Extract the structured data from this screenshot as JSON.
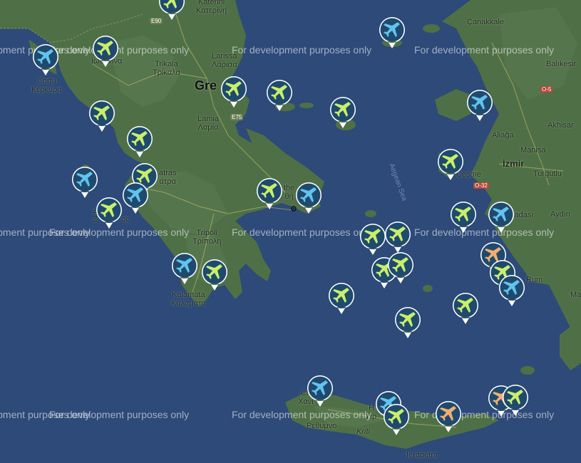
{
  "map": {
    "watermark_text": "For development purposes only",
    "sea_label": "Aegean Sea",
    "labels": [
      {
        "text": "Katerini\nΚατερίνη",
        "cls": ""
      },
      {
        "text": "Larissa\nΛάρισα",
        "cls": ""
      },
      {
        "text": "Trikala\nΤρίκαλα",
        "cls": ""
      },
      {
        "text": "Gre",
        "cls": "big"
      },
      {
        "text": "Lamia\nΛαμία",
        "cls": ""
      },
      {
        "text": "Corfu\nΚέρκυρα",
        "cls": ""
      },
      {
        "text": "atras\nάτρα",
        "cls": ""
      },
      {
        "text": "Tripoli\nΤρίπολη",
        "cls": ""
      },
      {
        "text": "Kalamata\nΚαλαμάτα",
        "cls": ""
      },
      {
        "text": "Çanakkale",
        "cls": ""
      },
      {
        "text": "Balıkesir",
        "cls": ""
      },
      {
        "text": "Akhisar",
        "cls": ""
      },
      {
        "text": "Aliağa",
        "cls": ""
      },
      {
        "text": "Manisa",
        "cls": ""
      },
      {
        "text": "İzmir",
        "cls": "bold"
      },
      {
        "text": "Turgutlu",
        "cls": ""
      },
      {
        "text": "Çeşme",
        "cls": ""
      },
      {
        "text": "şadası",
        "cls": ""
      },
      {
        "text": "Aydın",
        "cls": ""
      },
      {
        "text": "Rum",
        "cls": ""
      },
      {
        "text": "Ma",
        "cls": ""
      },
      {
        "text": "Ch\nΧανι",
        "cls": ""
      },
      {
        "text": "H\nΗρ",
        "cls": ""
      },
      {
        "text": "Ρέθυμνο",
        "cls": ""
      },
      {
        "text": "Kriti",
        "cls": "italic"
      },
      {
        "text": "Ierapetra",
        "cls": ""
      },
      {
        "text": "Z\nZ",
        "cls": ""
      },
      {
        "text": "ος",
        "cls": ""
      },
      {
        "text": "the\nθή",
        "cls": ""
      },
      {
        "text": "Ιωαννίνα",
        "cls": ""
      }
    ],
    "road_badges": [
      {
        "text": "E90",
        "color": "#6a7d55"
      },
      {
        "text": "E75",
        "color": "#6a7d55"
      },
      {
        "text": "O-5",
        "color": "#b34a3a"
      },
      {
        "text": "O-32",
        "color": "#b34a3a"
      }
    ],
    "marker_colors": {
      "green": "#c8ef6a",
      "blue": "#62c3ee",
      "orange": "#f2ad72"
    },
    "markers": [
      {
        "icon": "airplane-icon",
        "color": "green"
      },
      {
        "icon": "airplane-icon",
        "color": "blue"
      },
      {
        "icon": "airplane-icon",
        "color": "green"
      },
      {
        "icon": "airplane-icon",
        "color": "blue"
      },
      {
        "icon": "airplane-icon",
        "color": "green"
      },
      {
        "icon": "airplane-icon",
        "color": "green"
      },
      {
        "icon": "airplane-icon",
        "color": "green"
      },
      {
        "icon": "airplane-icon",
        "color": "green"
      },
      {
        "icon": "airplane-icon",
        "color": "blue"
      },
      {
        "icon": "airplane-icon",
        "color": "green"
      },
      {
        "icon": "airplane-icon",
        "color": "blue"
      },
      {
        "icon": "airplane-icon",
        "color": "green"
      },
      {
        "icon": "airplane-icon",
        "color": "green"
      },
      {
        "icon": "airplane-icon",
        "color": "blue"
      },
      {
        "icon": "airplane-icon",
        "color": "green"
      },
      {
        "icon": "airplane-icon",
        "color": "green"
      },
      {
        "icon": "airplane-icon",
        "color": "blue"
      },
      {
        "icon": "airplane-icon",
        "color": "green"
      },
      {
        "icon": "airplane-icon",
        "color": "green"
      },
      {
        "icon": "airplane-icon",
        "color": "green"
      },
      {
        "icon": "airplane-icon",
        "color": "green"
      },
      {
        "icon": "airplane-icon",
        "color": "green"
      },
      {
        "icon": "airplane-icon",
        "color": "green"
      },
      {
        "icon": "airplane-icon",
        "color": "green"
      },
      {
        "icon": "airplane-icon",
        "color": "blue"
      },
      {
        "icon": "airplane-icon",
        "color": "orange"
      },
      {
        "icon": "airplane-icon",
        "color": "green"
      },
      {
        "icon": "airplane-icon",
        "color": "blue"
      },
      {
        "icon": "airplane-icon",
        "color": "green"
      },
      {
        "icon": "airplane-icon",
        "color": "blue"
      },
      {
        "icon": "airplane-icon",
        "color": "green"
      },
      {
        "icon": "airplane-icon",
        "color": "blue"
      },
      {
        "icon": "airplane-icon",
        "color": "blue"
      },
      {
        "icon": "airplane-icon",
        "color": "green"
      },
      {
        "icon": "airplane-icon",
        "color": "orange"
      },
      {
        "icon": "airplane-icon",
        "color": "orange"
      },
      {
        "icon": "airplane-icon",
        "color": "green"
      }
    ]
  }
}
